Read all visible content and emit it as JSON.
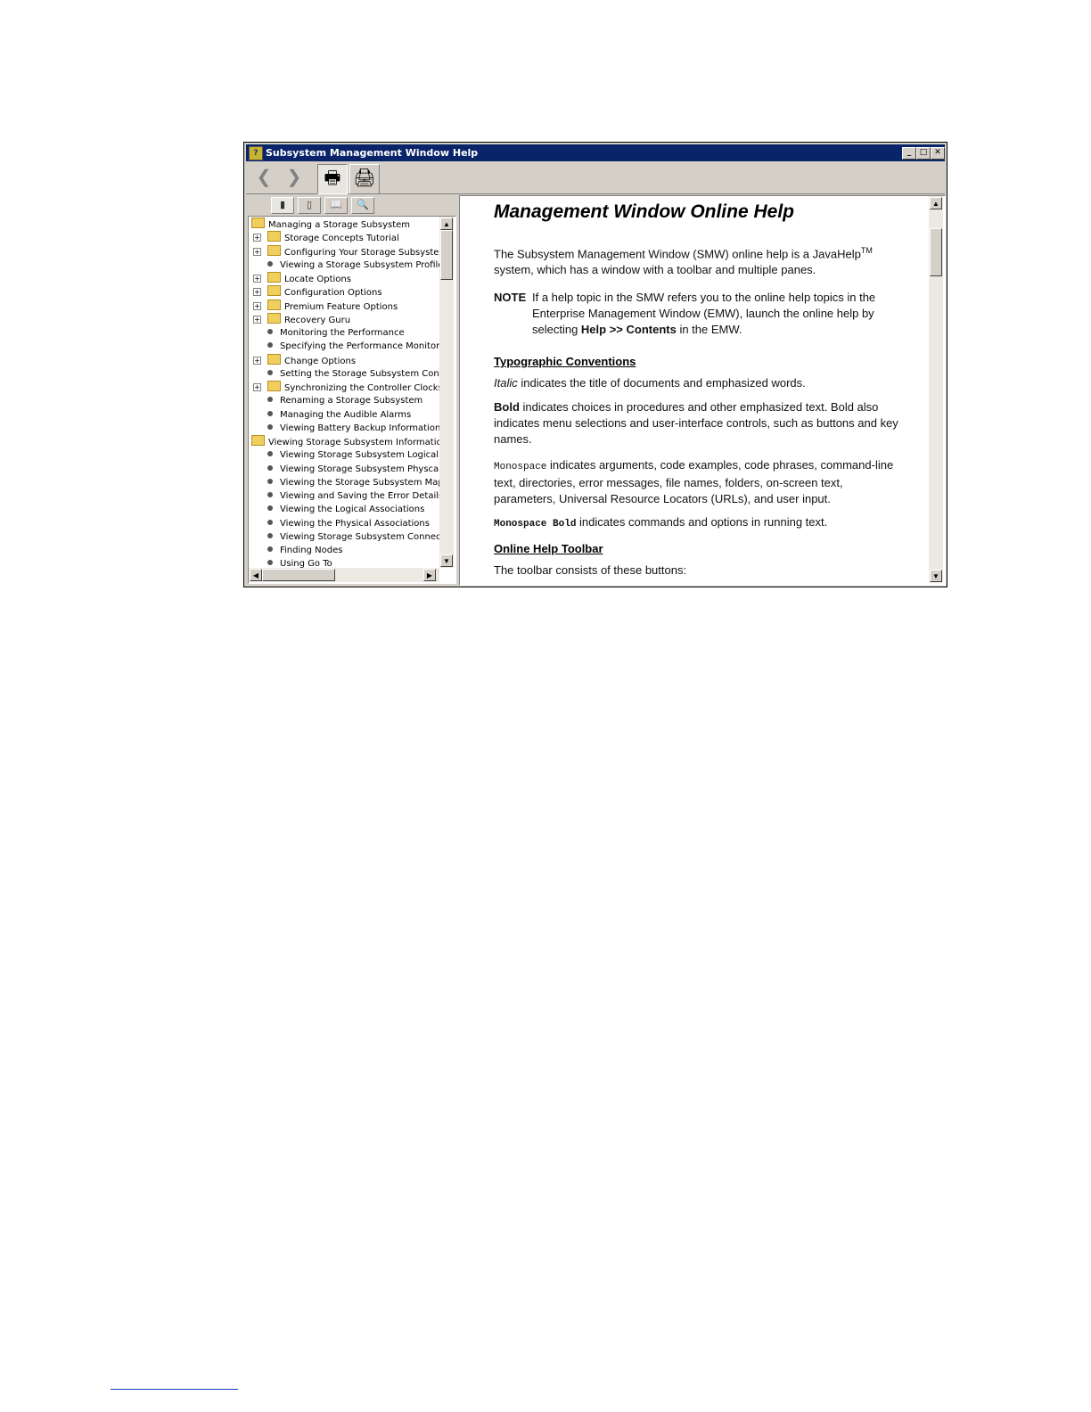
{
  "window": {
    "title": "Subsystem Management Window Help",
    "minimize": "_",
    "maximize": "□",
    "close": "✕"
  },
  "toolbar": {
    "back": "❮",
    "forward": "❯",
    "print": "🖶",
    "page_setup": "🖨"
  },
  "nav_tabs": [
    "▮",
    "▯",
    "📖",
    "🔍"
  ],
  "tree": [
    {
      "label": "Managing a Storage Subsystem",
      "level": 0,
      "icon": "folder",
      "expander": ""
    },
    {
      "label": "Storage Concepts Tutorial",
      "level": 1,
      "icon": "folder",
      "expander": "+"
    },
    {
      "label": "Configuring Your Storage Subsystem",
      "level": 1,
      "icon": "folder",
      "expander": "+"
    },
    {
      "label": "Viewing a Storage Subsystem Profile",
      "level": 1,
      "icon": "bullet",
      "expander": ""
    },
    {
      "label": "Locate Options",
      "level": 1,
      "icon": "folder",
      "expander": "+"
    },
    {
      "label": "Configuration Options",
      "level": 1,
      "icon": "folder",
      "expander": "+"
    },
    {
      "label": "Premium Feature Options",
      "level": 1,
      "icon": "folder",
      "expander": "+"
    },
    {
      "label": "Recovery Guru",
      "level": 1,
      "icon": "folder",
      "expander": "+"
    },
    {
      "label": "Monitoring the Performance",
      "level": 1,
      "icon": "bullet",
      "expander": ""
    },
    {
      "label": "Specifying the Performance Monitor S",
      "level": 1,
      "icon": "bullet",
      "expander": ""
    },
    {
      "label": "Change Options",
      "level": 1,
      "icon": "folder",
      "expander": "+"
    },
    {
      "label": "Setting the Storage Subsystem Contr",
      "level": 1,
      "icon": "bullet",
      "expander": ""
    },
    {
      "label": "Synchronizing the Controller Clocks",
      "level": 1,
      "icon": "folder",
      "expander": "+"
    },
    {
      "label": "Renaming a Storage Subsystem",
      "level": 1,
      "icon": "bullet",
      "expander": ""
    },
    {
      "label": "Managing the Audible Alarms",
      "level": 1,
      "icon": "bullet",
      "expander": ""
    },
    {
      "label": "Viewing Battery Backup Information",
      "level": 1,
      "icon": "bullet",
      "expander": ""
    },
    {
      "label": "Viewing Storage Subsystem Information",
      "level": 0,
      "icon": "folder",
      "expander": ""
    },
    {
      "label": "Viewing Storage Subsystem Logical Co",
      "level": 1,
      "icon": "bullet",
      "expander": ""
    },
    {
      "label": "Viewing Storage Subsystem Physcal C",
      "level": 1,
      "icon": "bullet",
      "expander": ""
    },
    {
      "label": "Viewing the Storage Subsystem Mapp",
      "level": 1,
      "icon": "bullet",
      "expander": ""
    },
    {
      "label": "Viewing and Saving the Error Details",
      "level": 1,
      "icon": "bullet",
      "expander": ""
    },
    {
      "label": "Viewing the Logical Associations",
      "level": 1,
      "icon": "bullet",
      "expander": ""
    },
    {
      "label": "Viewing the Physical Associations",
      "level": 1,
      "icon": "bullet",
      "expander": ""
    },
    {
      "label": "Viewing Storage Subsystem Connectio",
      "level": 1,
      "icon": "bullet",
      "expander": ""
    },
    {
      "label": "Finding Nodes",
      "level": 1,
      "icon": "bullet",
      "expander": ""
    },
    {
      "label": "Using Go To",
      "level": 1,
      "icon": "bullet",
      "expander": ""
    }
  ],
  "content": {
    "heading": "Management Window Online Help",
    "intro_1": "The Subsystem Management Window (SMW) online help is a JavaHelp",
    "intro_tm": "TM",
    "intro_2": "system, which has a window with a toolbar and multiple panes.",
    "note_label": "NOTE",
    "note_1": "If a help topic in the SMW refers you to the online help topics in the Enterprise Management Window (EMW), launch the online help by selecting ",
    "note_bold": "Help >> Contents",
    "note_2": " in the EMW.",
    "typo_heading": "Typographic Conventions",
    "italic_word": "Italic",
    "italic_desc": " indicates the title of documents and emphasized words.",
    "bold_word": "Bold",
    "bold_desc": " indicates choices in procedures and other emphasized text. Bold also indicates menu selections and user-interface controls, such as buttons and key names.",
    "mono_word": "Monospace",
    "mono_desc": " indicates arguments, code examples, code phrases, command-line text, directories, error messages, file names, folders, on-screen text, parameters, Universal Resource Locators (URLs), and user input.",
    "monobold_word": "Monospace Bold",
    "monobold_desc": " indicates commands and options in running text.",
    "toolbar_heading": "Online Help Toolbar",
    "toolbar_desc": "The toolbar consists of these buttons:"
  },
  "scroll": {
    "up": "▲",
    "down": "▼",
    "left": "◀",
    "right": "▶"
  }
}
